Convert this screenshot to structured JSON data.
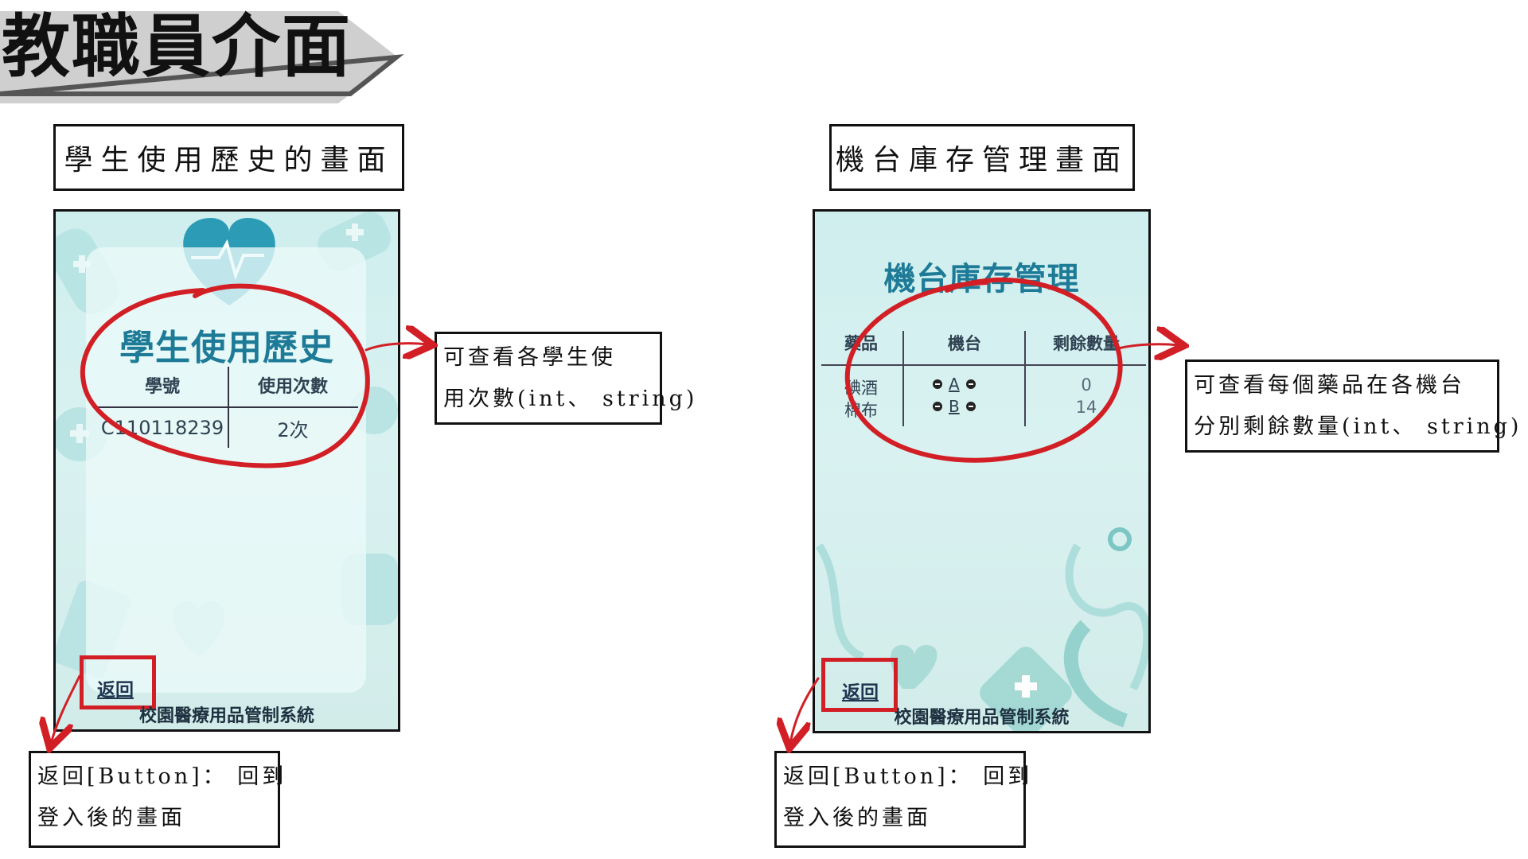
{
  "page": {
    "title": "教職員介面"
  },
  "sections": {
    "history": {
      "label": "學生使用歷史的畫面",
      "screen": {
        "heading": "學生使用歷史",
        "columns": [
          "學號",
          "使用次數"
        ],
        "rows": [
          {
            "student_id": "C110118239",
            "usage_count": "2次"
          }
        ],
        "back_label": "返回",
        "footer": "校園醫療用品管制系統"
      },
      "note": [
        "可查看各學生使",
        "用次數(int、 string)"
      ],
      "back_note": [
        "返回[Button]： 回到",
        "登入後的畫面"
      ]
    },
    "inventory": {
      "label": "機台庫存管理畫面",
      "screen": {
        "heading": "機台庫存管理",
        "columns": [
          "藥品",
          "機台",
          "剩餘數量"
        ],
        "rows": [
          {
            "item": "碘酒",
            "machine": "A",
            "remaining": "0"
          },
          {
            "item": "棉布",
            "machine": "B",
            "remaining": "14"
          }
        ],
        "back_label": "返回",
        "footer": "校園醫療用品管制系統"
      },
      "note": [
        "可查看每個藥品在各機台",
        "分別剩餘數量(int、 string)"
      ],
      "back_note": [
        "返回[Button]： 回到",
        "登入後的畫面"
      ]
    }
  },
  "colors": {
    "annotation_red": "#d21f26",
    "heading_teal": "#1e7b97",
    "title_banner_gray": "#c9c9c9"
  }
}
